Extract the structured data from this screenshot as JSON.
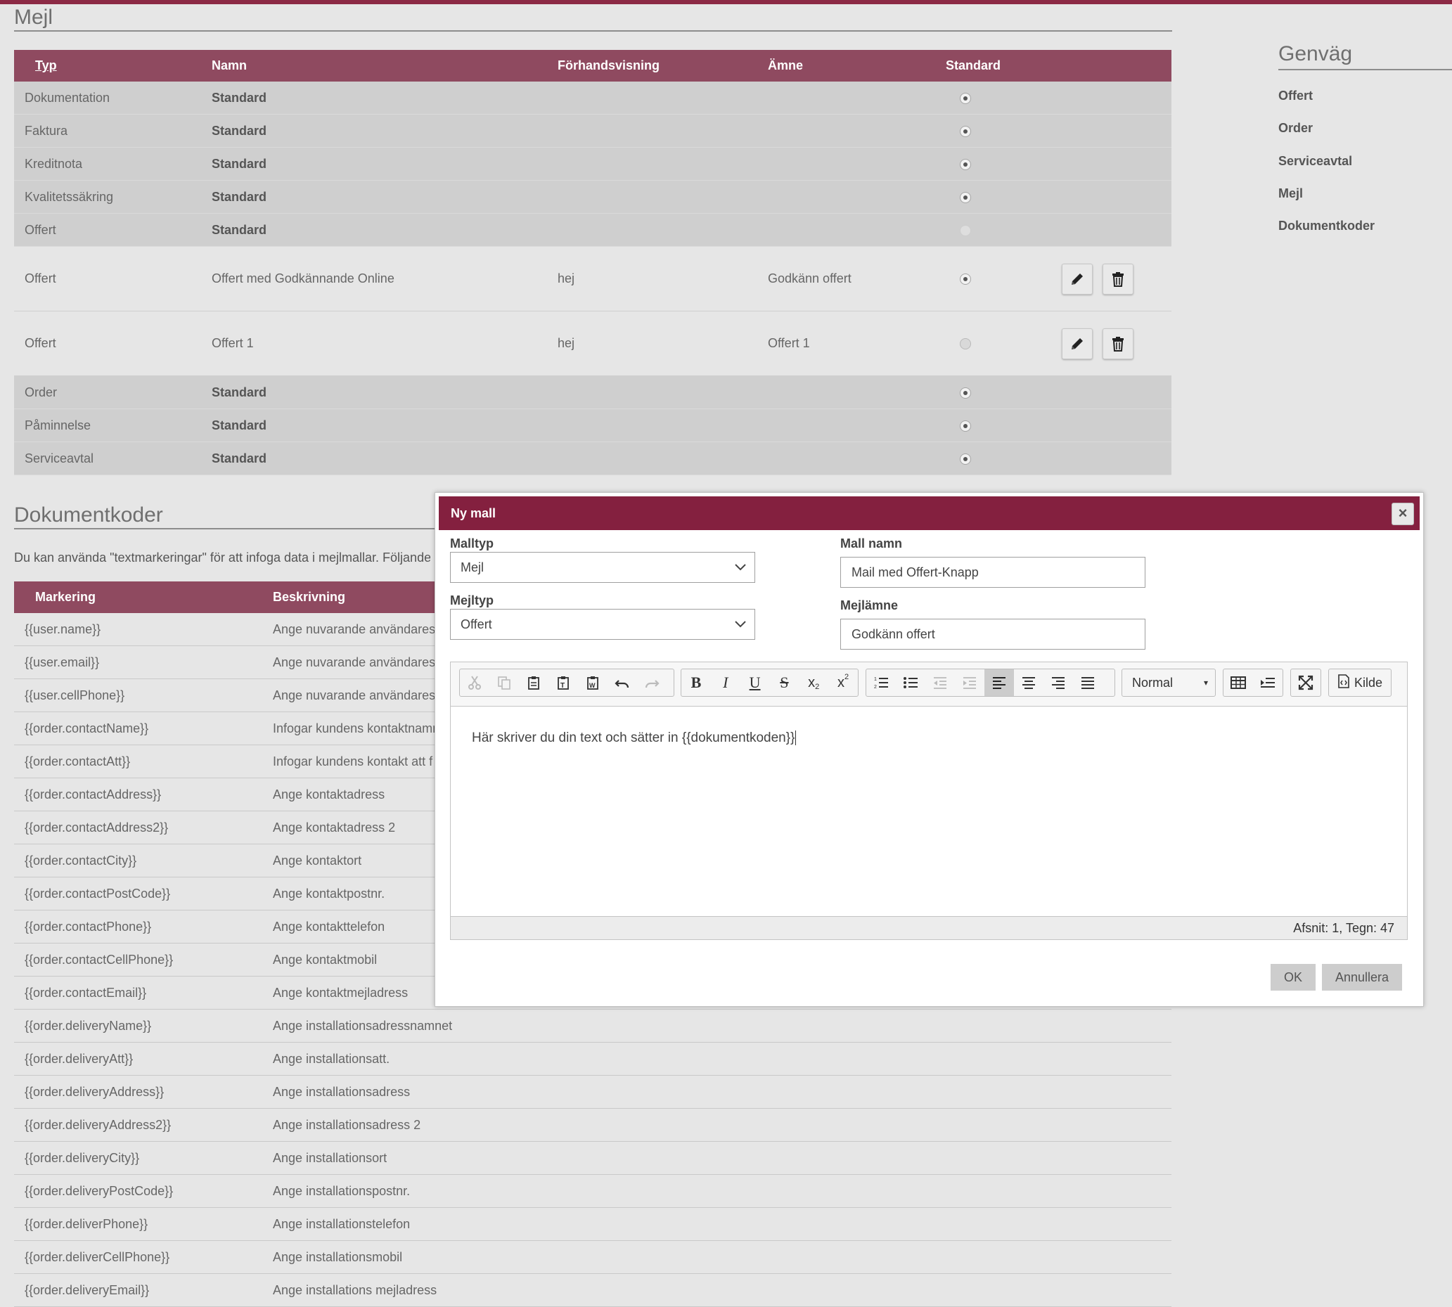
{
  "mail_section": {
    "title": "Mejl",
    "columns": [
      "Typ",
      "Namn",
      "Förhandsvisning",
      "Ämne",
      "Standard"
    ],
    "rows": [
      {
        "type": "Dokumentation",
        "name": "Standard",
        "preview": "",
        "subject": "",
        "default": "on",
        "kind": "std"
      },
      {
        "type": "Faktura",
        "name": "Standard",
        "preview": "",
        "subject": "",
        "default": "on",
        "kind": "std"
      },
      {
        "type": "Kreditnota",
        "name": "Standard",
        "preview": "",
        "subject": "",
        "default": "on",
        "kind": "std"
      },
      {
        "type": "Kvalitetssäkring",
        "name": "Standard",
        "preview": "",
        "subject": "",
        "default": "on",
        "kind": "std"
      },
      {
        "type": "Offert",
        "name": "Standard",
        "preview": "",
        "subject": "",
        "default": "empty",
        "kind": "std"
      },
      {
        "type": "Offert",
        "name": "Offert med Godkännande Online",
        "preview": "hej",
        "subject": "Godkänn offert",
        "default": "on",
        "kind": "cust"
      },
      {
        "type": "Offert",
        "name": "Offert 1",
        "preview": "hej",
        "subject": "Offert 1",
        "default": "off",
        "kind": "cust"
      },
      {
        "type": "Order",
        "name": "Standard",
        "preview": "",
        "subject": "",
        "default": "on",
        "kind": "std"
      },
      {
        "type": "Påminnelse",
        "name": "Standard",
        "preview": "",
        "subject": "",
        "default": "on",
        "kind": "std"
      },
      {
        "type": "Serviceavtal",
        "name": "Standard",
        "preview": "",
        "subject": "",
        "default": "on",
        "kind": "std"
      }
    ]
  },
  "shortcuts": {
    "title": "Genväg",
    "links": [
      "Offert",
      "Order",
      "Serviceavtal",
      "Mejl",
      "Dokumentkoder"
    ]
  },
  "doc_codes": {
    "title": "Dokumentkoder",
    "intro": "Du kan använda \"textmarkeringar\" för att infoga data i mejlmallar. Följande",
    "columns": [
      "Markering",
      "Beskrivning"
    ],
    "rows": [
      {
        "code": "{{user.name}}",
        "desc": "Ange nuvarande användares"
      },
      {
        "code": "{{user.email}}",
        "desc": "Ange nuvarande användares"
      },
      {
        "code": "{{user.cellPhone}}",
        "desc": "Ange nuvarande användares"
      },
      {
        "code": "{{order.contactName}}",
        "desc": "Infogar kundens kontaktnamn"
      },
      {
        "code": "{{order.contactAtt}}",
        "desc": "Infogar kundens kontakt att f"
      },
      {
        "code": "{{order.contactAddress}}",
        "desc": "Ange kontaktadress"
      },
      {
        "code": "{{order.contactAddress2}}",
        "desc": "Ange kontaktadress 2"
      },
      {
        "code": "{{order.contactCity}}",
        "desc": "Ange kontaktort"
      },
      {
        "code": "{{order.contactPostCode}}",
        "desc": "Ange kontaktpostnr."
      },
      {
        "code": "{{order.contactPhone}}",
        "desc": "Ange kontakttelefon"
      },
      {
        "code": "{{order.contactCellPhone}}",
        "desc": "Ange kontaktmobil"
      },
      {
        "code": "{{order.contactEmail}}",
        "desc": "Ange kontaktmejladress"
      },
      {
        "code": "{{order.deliveryName}}",
        "desc": "Ange installationsadressnamnet"
      },
      {
        "code": "{{order.deliveryAtt}}",
        "desc": "Ange installationsatt."
      },
      {
        "code": "{{order.deliveryAddress}}",
        "desc": "Ange installationsadress"
      },
      {
        "code": "{{order.deliveryAddress2}}",
        "desc": "Ange installationsadress 2"
      },
      {
        "code": "{{order.deliveryCity}}",
        "desc": "Ange installationsort"
      },
      {
        "code": "{{order.deliveryPostCode}}",
        "desc": "Ange installationspostnr."
      },
      {
        "code": "{{order.deliverPhone}}",
        "desc": "Ange installationstelefon"
      },
      {
        "code": "{{order.deliverCellPhone}}",
        "desc": "Ange installationsmobil"
      },
      {
        "code": "{{order.deliveryEmail}}",
        "desc": "Ange installations mejladress"
      }
    ]
  },
  "modal": {
    "title": "Ny mall",
    "close_label": "×",
    "template_type_label": "Malltyp",
    "template_type_value": "Mejl",
    "mail_type_label": "Mejltyp",
    "mail_type_value": "Offert",
    "template_name_label": "Mall namn",
    "template_name_value": "Mail med Offert-Knapp",
    "subject_label": "Mejlämne",
    "subject_value": "Godkänn offert",
    "format_select": "Normal",
    "source_label": "Kilde",
    "editor_text": "Här skriver du din text och sätter in {{dokumentkoden}}",
    "status_text": "Afsnit: 1, Tegn: 47",
    "ok_label": "OK",
    "cancel_label": "Annullera"
  },
  "colors": {
    "header_bar": "#8f4a60",
    "modal_header": "#84203f",
    "top_accent": "#8c2a45"
  }
}
